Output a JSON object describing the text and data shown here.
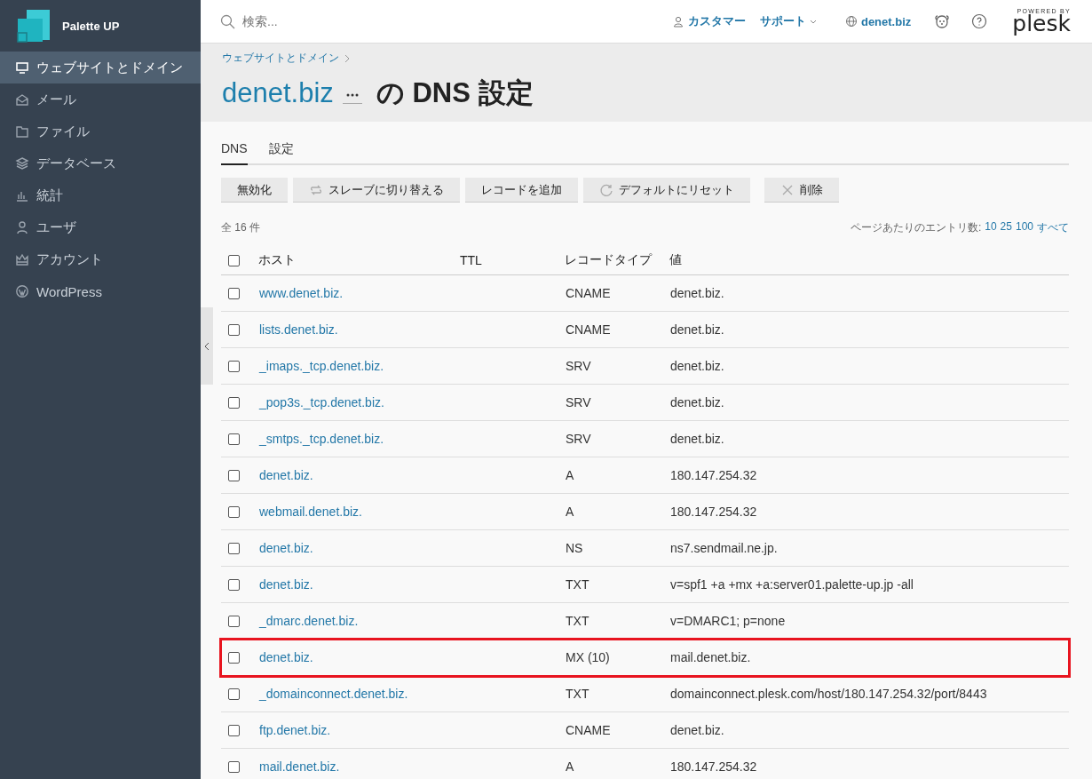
{
  "sidebar": {
    "brand": "Palette UP",
    "items": [
      {
        "label": "ウェブサイトとドメイン",
        "selected": true
      },
      {
        "label": "メール",
        "selected": false
      },
      {
        "label": "ファイル",
        "selected": false
      },
      {
        "label": "データベース",
        "selected": false
      },
      {
        "label": "統計",
        "selected": false
      },
      {
        "label": "ユーザ",
        "selected": false
      },
      {
        "label": "アカウント",
        "selected": false
      },
      {
        "label": "WordPress",
        "selected": false
      }
    ]
  },
  "topbar": {
    "search_placeholder": "検索...",
    "links": [
      "カスタマー",
      "サポート",
      "denet.biz"
    ],
    "powered_by": "POWERED BY",
    "product": "plesk"
  },
  "header": {
    "breadcrumb": "ウェブサイトとドメイン",
    "domain": "denet.biz",
    "title": "の DNS 設定"
  },
  "tabs": [
    {
      "label": "DNS",
      "selected": true
    },
    {
      "label": "設定",
      "selected": false
    }
  ],
  "toolbar": [
    "無効化",
    "スレーブに切り替える",
    "レコードを追加",
    "デフォルトにリセット",
    "削除"
  ],
  "total": "全 16 件",
  "per_page": {
    "label": "ページあたりのエントリ数:",
    "options": [
      "10",
      "25",
      "100",
      "すべて"
    ]
  },
  "table": {
    "columns": [
      "ホスト",
      "TTL",
      "レコードタイプ",
      "値"
    ],
    "all_checked": false,
    "rows": [
      {
        "host": "www.denet.biz.",
        "type": "CNAME",
        "value": "denet.biz.",
        "checked": false,
        "highlighted": false
      },
      {
        "host": "lists.denet.biz.",
        "type": "CNAME",
        "value": "denet.biz.",
        "checked": false,
        "highlighted": false
      },
      {
        "host": "_imaps._tcp.denet.biz.",
        "type": "SRV",
        "value": "denet.biz.",
        "checked": false,
        "highlighted": false
      },
      {
        "host": "_pop3s._tcp.denet.biz.",
        "type": "SRV",
        "value": "denet.biz.",
        "checked": false,
        "highlighted": false
      },
      {
        "host": "_smtps._tcp.denet.biz.",
        "type": "SRV",
        "value": "denet.biz.",
        "checked": false,
        "highlighted": false
      },
      {
        "host": "denet.biz.",
        "type": "A",
        "value": "180.147.254.32",
        "checked": false,
        "highlighted": false
      },
      {
        "host": "webmail.denet.biz.",
        "type": "A",
        "value": "180.147.254.32",
        "checked": false,
        "highlighted": false
      },
      {
        "host": "denet.biz.",
        "type": "NS",
        "value": "ns7.sendmail.ne.jp.",
        "checked": false,
        "highlighted": false
      },
      {
        "host": "denet.biz.",
        "type": "TXT",
        "value": "v=spf1 +a +mx +a:server01.palette-up.jp -all",
        "checked": false,
        "highlighted": false
      },
      {
        "host": "_dmarc.denet.biz.",
        "type": "TXT",
        "value": "v=DMARC1; p=none",
        "checked": false,
        "highlighted": false
      },
      {
        "host": "denet.biz.",
        "type": "MX (10)",
        "value": "mail.denet.biz.",
        "checked": false,
        "highlighted": true
      },
      {
        "host": "_domainconnect.denet.biz.",
        "type": "TXT",
        "value": "domainconnect.plesk.com/host/180.147.254.32/port/8443",
        "checked": false,
        "highlighted": false
      },
      {
        "host": "ftp.denet.biz.",
        "type": "CNAME",
        "value": "denet.biz.",
        "checked": false,
        "highlighted": false
      },
      {
        "host": "mail.denet.biz.",
        "type": "A",
        "value": "180.147.254.32",
        "checked": false,
        "highlighted": false
      }
    ]
  }
}
